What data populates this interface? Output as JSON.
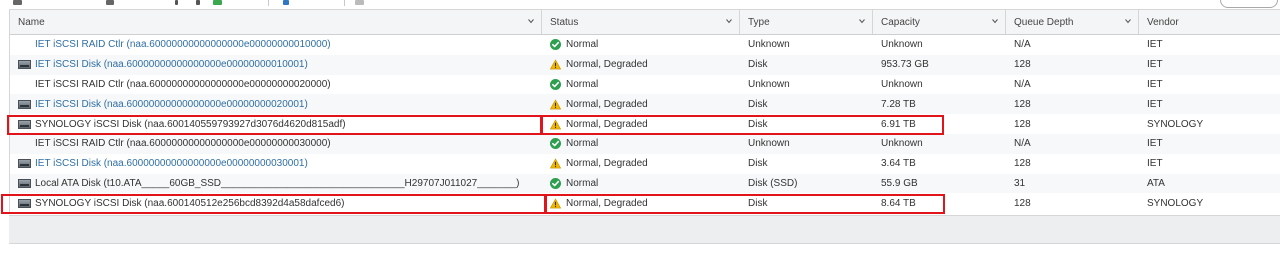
{
  "columns": [
    {
      "key": "name",
      "label": "Name"
    },
    {
      "key": "status",
      "label": "Status"
    },
    {
      "key": "type",
      "label": "Type"
    },
    {
      "key": "capacity",
      "label": "Capacity"
    },
    {
      "key": "queue_depth",
      "label": "Queue Depth"
    },
    {
      "key": "vendor",
      "label": "Vendor"
    }
  ],
  "rows": [
    {
      "name": "IET iSCSI RAID Ctlr (naa.60000000000000000e00000000010000)",
      "icon": "none",
      "name_style": "link",
      "status": "Normal",
      "status_icon": "check-circle-icon",
      "type": "Unknown",
      "capacity": "Unknown",
      "queue_depth": "N/A",
      "vendor": "IET"
    },
    {
      "name": "IET iSCSI Disk (naa.60000000000000000e00000000010001)",
      "icon": "disk-icon",
      "name_style": "link",
      "status": "Normal, Degraded",
      "status_icon": "warning-icon",
      "type": "Disk",
      "capacity": "953.73 GB",
      "queue_depth": "128",
      "vendor": "IET"
    },
    {
      "name": "IET iSCSI RAID Ctlr (naa.60000000000000000e00000000020000)",
      "icon": "none",
      "name_style": "dark",
      "status": "Normal",
      "status_icon": "check-circle-icon",
      "type": "Unknown",
      "capacity": "Unknown",
      "queue_depth": "N/A",
      "vendor": "IET"
    },
    {
      "name": "IET iSCSI Disk (naa.60000000000000000e00000000020001)",
      "icon": "disk-icon",
      "name_style": "link",
      "status": "Normal, Degraded",
      "status_icon": "warning-icon",
      "type": "Disk",
      "capacity": "7.28 TB",
      "queue_depth": "128",
      "vendor": "IET"
    },
    {
      "name": "SYNOLOGY iSCSI Disk (naa.6001405597939​27d3076d4620d815adf)",
      "icon": "disk-icon",
      "name_style": "dark",
      "status": "Normal, Degraded",
      "status_icon": "warning-icon",
      "type": "Disk",
      "capacity": "6.91 TB",
      "queue_depth": "128",
      "vendor": "SYNOLOGY"
    },
    {
      "name": "IET iSCSI RAID Ctlr (naa.60000000000000000e00000000030000)",
      "icon": "none",
      "name_style": "dark",
      "status": "Normal",
      "status_icon": "check-circle-icon",
      "type": "Unknown",
      "capacity": "Unknown",
      "queue_depth": "N/A",
      "vendor": "IET"
    },
    {
      "name": "IET iSCSI Disk (naa.60000000000000000e00000000030001)",
      "icon": "disk-icon",
      "name_style": "link",
      "status": "Normal, Degraded",
      "status_icon": "warning-icon",
      "type": "Disk",
      "capacity": "3.64 TB",
      "queue_depth": "128",
      "vendor": "IET"
    },
    {
      "name": "Local ATA Disk (t10.ATA_____60GB_SSD_________________________________H29707J011027_______)",
      "icon": "disk-icon",
      "name_style": "dark",
      "status": "Normal",
      "status_icon": "check-circle-icon",
      "type": "Disk (SSD)",
      "capacity": "55.9 GB",
      "queue_depth": "31",
      "vendor": "ATA"
    },
    {
      "name": "SYNOLOGY iSCSI Disk (naa.600140512e256bcd8392d4a58dafced6)",
      "icon": "disk-icon",
      "name_style": "dark",
      "status": "Normal, Degraded",
      "status_icon": "warning-icon",
      "type": "Disk",
      "capacity": "8.64 TB",
      "queue_depth": "128",
      "vendor": "SYNOLOGY"
    }
  ],
  "highlighted_rows": [
    4,
    8
  ],
  "colors": {
    "highlight": "#e0141a",
    "link": "#2f6fa5",
    "ok": "#2e9e4f",
    "warn": "#f2b800"
  }
}
